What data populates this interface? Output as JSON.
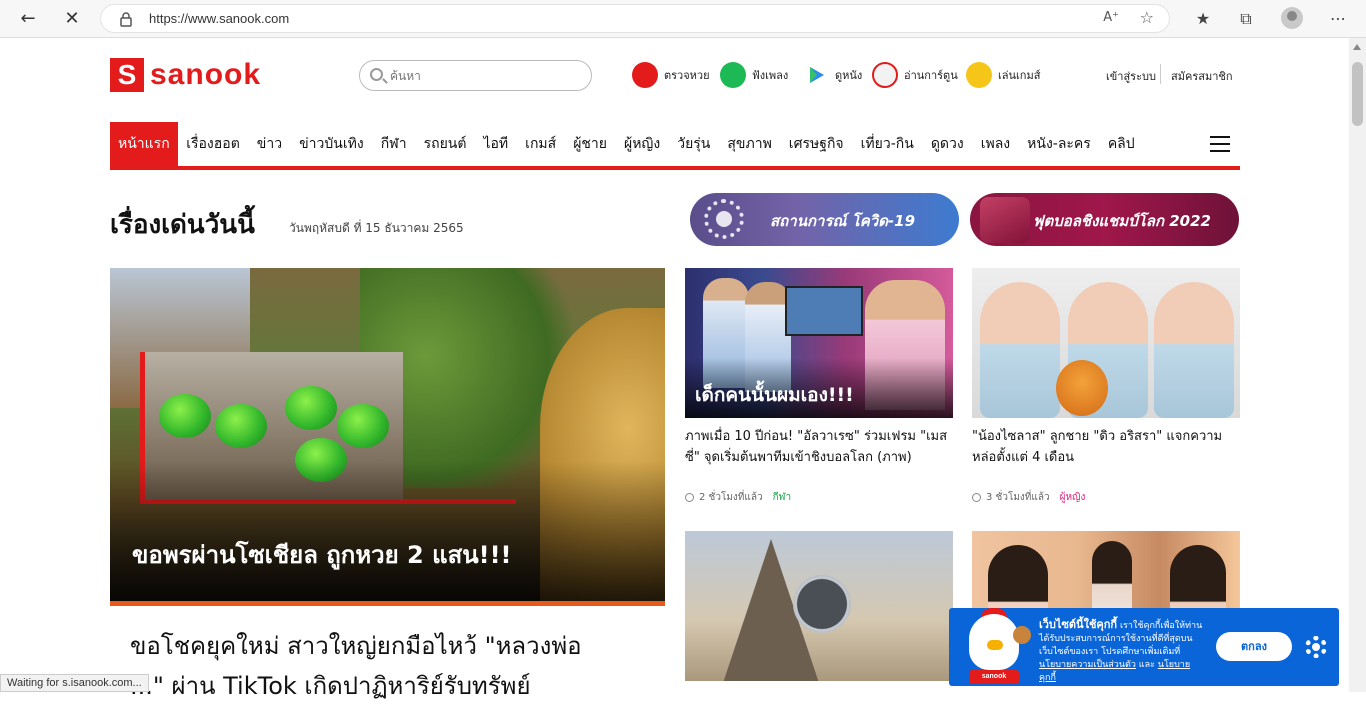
{
  "browser": {
    "url": "https://www.sanook.com",
    "read_aloud": "Aͅ",
    "status": "Waiting for s.isanook.com..."
  },
  "site": {
    "logo_letter": "S",
    "logo_word": "sanook",
    "search_placeholder": "ค้นหา",
    "quick_links": [
      {
        "label": "ตรวจหวย",
        "color": "#e41b1b"
      },
      {
        "label": "ฟังเพลง",
        "color": "#1db954"
      },
      {
        "label": "ดูหนัง",
        "color": "#2b8cf0"
      },
      {
        "label": "อ่านการ์ตูน",
        "color": "#f2f2f2"
      },
      {
        "label": "เล่นเกมส์",
        "color": "#f5c518"
      }
    ],
    "login": "เข้าสู่ระบบ",
    "signup": "สมัครสมาชิก"
  },
  "menu": [
    "หน้าแรก",
    "เรื่องฮอต",
    "ข่าว",
    "ข่าวบันเทิง",
    "กีฬา",
    "รถยนต์",
    "ไอที",
    "เกมส์",
    "ผู้ชาย",
    "ผู้หญิง",
    "วัยรุ่น",
    "สุขภาพ",
    "เศรษฐกิจ",
    "เที่ยว-กิน",
    "ดูดวง",
    "เพลง",
    "หนัง-ละคร",
    "คลิป"
  ],
  "headline": {
    "title": "เรื่องเด่นวันนี้",
    "date": "วันพฤหัสบดี ที่ 15 ธันวาคม 2565",
    "banner_covid": "สถานการณ์ โควิด-19",
    "banner_worldcup": "ฟุตบอลชิงแชมป์โลก 2022"
  },
  "hero": {
    "caption": "ขอพรผ่านโซเชียล ถูกหวย 2 แสน!!!",
    "title_line1": "ขอโชคยุคใหม่ สาวใหญ่ยกมือไหว้ \"หลวงพ่อ",
    "title_line2": "...\" ผ่าน TikTok เกิดปาฏิหาริย์รับทรัพย์"
  },
  "cards": [
    {
      "overlay": "เด็กคนนั้นผมเอง!!!",
      "title": "ภาพเมื่อ 10 ปีก่อน! \"อัลวาเรซ\" ร่วมเฟรม \"เมสซี่\" จุดเริ่มต้นพาทีมเข้าชิงบอลโลก (ภาพ)",
      "time": "2 ชั่วโมงที่แล้ว",
      "category": "กีฬา",
      "cat_color": "#1aa34a"
    },
    {
      "overlay": "",
      "title": "\"น้องไซลาส\" ลูกชาย \"ดิว อริสรา\" แจกความหล่อตั้งแต่ 4 เดือน",
      "time": "3 ชั่วโมงที่แล้ว",
      "category": "ผู้หญิง",
      "cat_color": "#e0217a"
    }
  ],
  "cookie": {
    "heading": "เว็บไซต์นี้ใช้คุกกี้",
    "body": "เราใช้คุกกี้เพื่อให้ท่านได้รับประสบการณ์การใช้งานที่ดีที่สุดบนเว็บไซต์ของเรา โปรดศึกษาเพิ่มเติมที่",
    "privacy_link": "นโยบายความเป็นส่วนตัว",
    "and": "และ",
    "cookie_link": "นโยบายคุกกี้",
    "ok": "ตกลง",
    "mascot_name": "sanook"
  }
}
